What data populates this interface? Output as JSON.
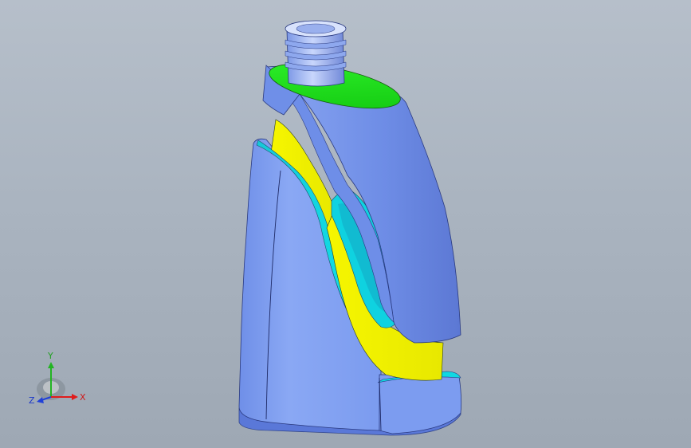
{
  "triad": {
    "x_label": "X",
    "y_label": "Y",
    "z_label": "Z",
    "colors": {
      "x": "#e01c1c",
      "y": "#22b422",
      "z": "#2040d8"
    }
  },
  "model": {
    "body_color": "#7e9ef0",
    "section_face_color": "#f0f000",
    "top_section_color": "#22e01e",
    "inner_wall_color": "#12d8e0"
  }
}
